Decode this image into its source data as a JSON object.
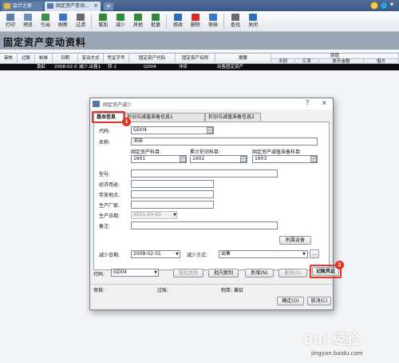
{
  "tabs": {
    "tab1_label": "会计之家",
    "tab2_label": "固定资产变动...",
    "add_label": "+"
  },
  "toolbar": {
    "buttons": [
      {
        "label": "打印",
        "icon": "printer-icon",
        "color": "#5a7ea8"
      },
      {
        "label": "预览",
        "icon": "preview-icon",
        "color": "#6d8fb6"
      },
      {
        "label": "引出",
        "icon": "export-icon",
        "color": "#3f8f4a"
      },
      {
        "label": "刷新",
        "icon": "refresh-icon",
        "color": "#3a78c2"
      },
      {
        "label": "过滤",
        "icon": "filter-icon",
        "color": "#6a6a6a"
      },
      {
        "label": "增加",
        "icon": "add-icon",
        "color": "#2f8a3a"
      },
      {
        "label": "减少",
        "icon": "reduce-icon",
        "color": "#2f8a3a"
      },
      {
        "label": "其他",
        "icon": "other-icon",
        "color": "#2f8a3a"
      },
      {
        "label": "批量",
        "icon": "batch-icon",
        "color": "#2f8a3a"
      },
      {
        "label": "修改",
        "icon": "edit-icon",
        "color": "#2e6fb8"
      },
      {
        "label": "删除",
        "icon": "delete-icon",
        "color": "#d12b2b"
      },
      {
        "label": "审核",
        "icon": "audit-icon",
        "color": "#3a78c2"
      },
      {
        "label": "查找",
        "icon": "find-icon",
        "color": "#6a6a6a"
      },
      {
        "label": "关闭",
        "icon": "close-icon",
        "color": "#2e6fb8"
      }
    ]
  },
  "page": {
    "title": "固定资产变动资料"
  },
  "grid": {
    "headers": [
      "审核",
      "过账",
      "制单",
      "日期",
      "变动方式",
      "凭证字号",
      "固定资产代码",
      "固定资产名称",
      "摘要"
    ],
    "group_header": "原值",
    "sub_headers": [
      "币别",
      "汇率",
      "原币金额",
      "借方"
    ],
    "row": [
      "",
      "",
      "黄虹",
      "2008-02-0",
      "减少:出售1",
      "转-1",
      "GD04",
      "冲床",
      "出售固定资产"
    ]
  },
  "dialog": {
    "title": "固定资产减少",
    "help": "?",
    "close": "×",
    "tabs": [
      "基本信息",
      "折旧与减值准备信息1",
      "折旧与减值准备信息2"
    ],
    "badge1": "1",
    "badge2": "2",
    "form": {
      "code_label": "代码:",
      "code_value": "GD04",
      "name_label": "名称:",
      "name_value": "冲床",
      "asset_account_label": "固定资产科目:",
      "asset_account_value": "1601",
      "depr_account_label": "累计折旧科目:",
      "depr_account_value": "1602",
      "impair_account_label": "固定资产减值准备科目:",
      "impair_account_value": "1603",
      "model_label": "型号:",
      "usage_label": "经济用途:",
      "location_label": "存放地点:",
      "maker_label": "生产厂家:",
      "prod_date_label": "生产日期:",
      "prod_date_value": "2021-03-03",
      "remark_label": "备注:",
      "attach_button": "附属设备",
      "reduce_date_label": "减少日期:",
      "reduce_date_value": "2008-02-01",
      "reduce_method_label": "减少方式:",
      "reduce_method_value": "出售",
      "more_button": "..."
    },
    "bottom": {
      "code_label": "代码:",
      "code_value": "GD04",
      "whole_copy": "整批复制",
      "batch_copy": "批内复制",
      "add": "新增(N)",
      "delete": "删除(D)",
      "record_voucher": "记账凭证",
      "audit_label": "审核:",
      "post_label": "过账:",
      "maker_label": "制单:",
      "maker_value": "黄虹",
      "ok": "确定(O)",
      "cancel": "取消(C)"
    }
  },
  "watermark": {
    "logo": "Bai 经验",
    "url": "jingyan.baidu.com"
  },
  "colors": {
    "highlight": "#e0362a",
    "selected_row": "#0e0e12",
    "tab_bar": "#3a5a86"
  }
}
